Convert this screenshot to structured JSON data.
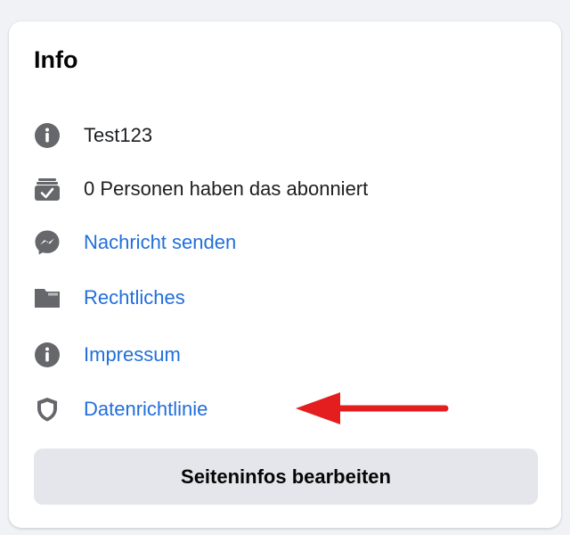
{
  "panel": {
    "title": "Info",
    "items": [
      {
        "icon": "info-icon",
        "label": "Test123",
        "link": false
      },
      {
        "icon": "subscribers-icon",
        "label": "0 Personen haben das abonniert",
        "link": false
      },
      {
        "icon": "messenger-icon",
        "label": "Nachricht senden",
        "link": true
      },
      {
        "icon": "folder-icon",
        "label": "Rechtliches",
        "link": true
      },
      {
        "icon": "info-icon",
        "label": "Impressum",
        "link": true
      },
      {
        "icon": "shield-icon",
        "label": "Datenrichtlinie",
        "link": true
      }
    ],
    "edit_button_label": "Seiteninfos bearbeiten"
  },
  "colors": {
    "link": "#216fdb",
    "icon": "#65676b",
    "button_bg": "#e4e6eb",
    "annotation_arrow": "#e41e1e"
  }
}
